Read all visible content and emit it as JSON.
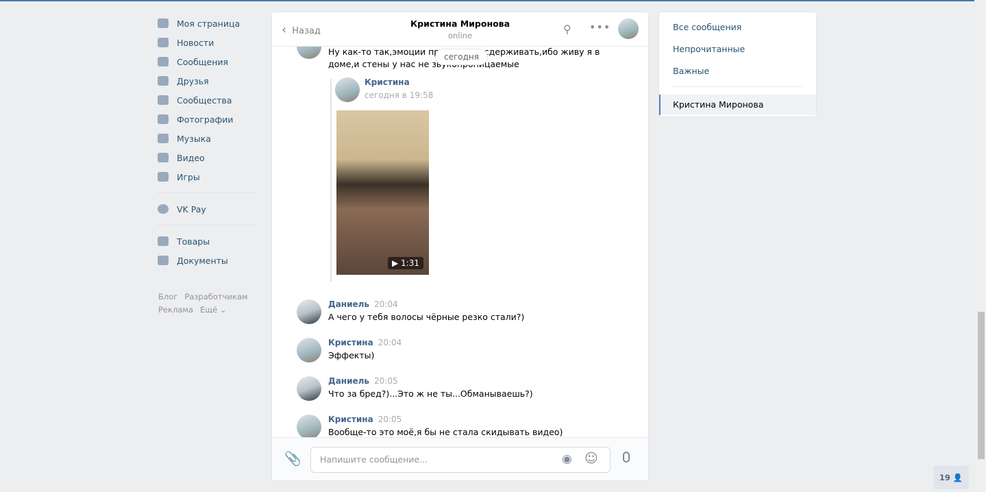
{
  "nav": {
    "items": [
      "Моя страница",
      "Новости",
      "Сообщения",
      "Друзья",
      "Сообщества",
      "Фотографии",
      "Музыка",
      "Видео",
      "Игры"
    ],
    "pay": "VK Pay",
    "extra": [
      "Товары",
      "Документы"
    ],
    "footer": [
      "Блог",
      "Разработчикам",
      "Реклама",
      "Ещё ⌄"
    ]
  },
  "header": {
    "back": "Назад",
    "title": "Кристина Миронова",
    "status": "online"
  },
  "date_pill": "сегодня",
  "messages": [
    {
      "text1": "Ну как-то так,эмоции приходится сдерживать,ибо живу я в",
      "text2": "доме,и стены у нас не звукопроницаемые"
    },
    {
      "fwd_name": "Кристина",
      "fwd_time": "сегодня в 19:58",
      "video_duration": "▶ 1:31"
    },
    {
      "name": "Даниель",
      "time": "20:04",
      "text": "А чего у тебя волосы чёрные резко стали?)"
    },
    {
      "name": "Кристина",
      "time": "20:04",
      "text": "Эффекты)"
    },
    {
      "name": "Даниель",
      "time": "20:05",
      "text": "Что за бред?)...Это ж не ты...Обманываешь?)"
    },
    {
      "name": "Кристина",
      "time": "20:05",
      "text": "Вообще-то это моё,я бы не стала скидывать видео)"
    }
  ],
  "compose": {
    "placeholder": "Напишите сообщение..."
  },
  "right": {
    "items": [
      "Все сообщения",
      "Непрочитанные",
      "Важные"
    ],
    "active": "Кристина Миронова"
  },
  "badge": "19"
}
